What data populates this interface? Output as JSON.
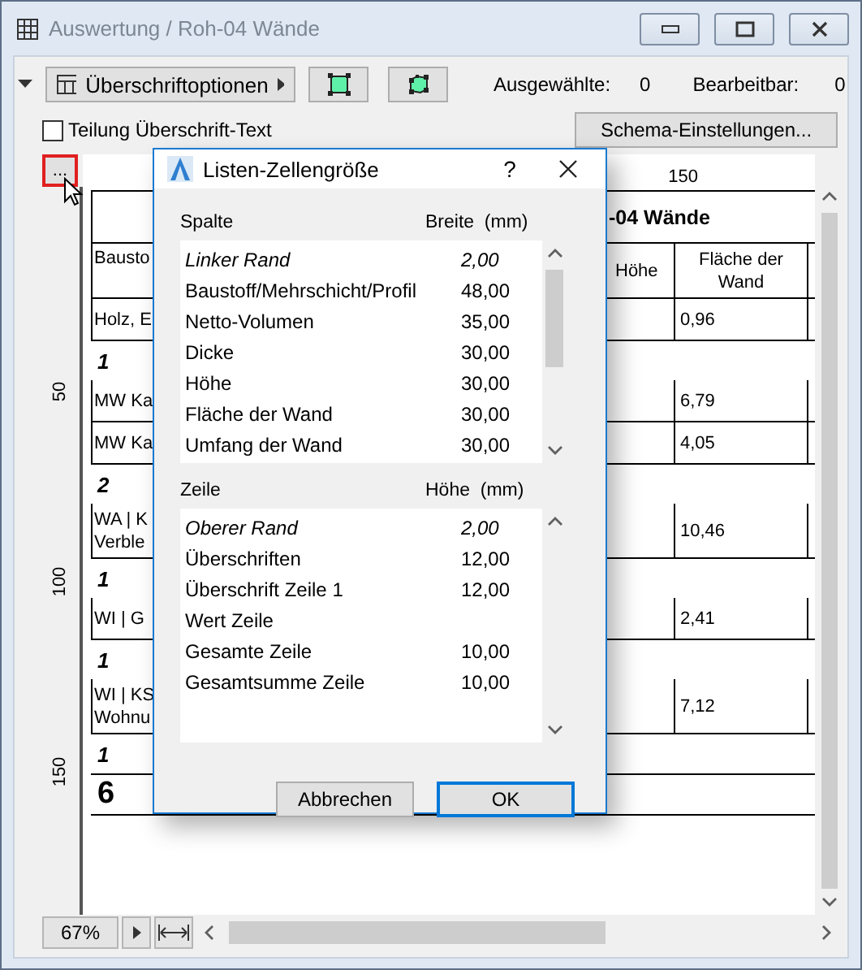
{
  "window": {
    "title": "Auswertung / Roh-04 Wände"
  },
  "toolbar": {
    "options_button": "Überschriftoptionen",
    "selected_label": "Ausgewählte:",
    "selected_count": "0",
    "editable_label": "Bearbeitbar:",
    "editable_count": "0"
  },
  "split_checkbox": {
    "label": "Teilung Überschrift-Text",
    "checked": false
  },
  "schema_button": "Schema-Einstellungen...",
  "more_button": "...",
  "ruler": {
    "top_label": "150",
    "side_labels": [
      "50",
      "100",
      "150"
    ]
  },
  "schedule": {
    "title": "-04 Wände",
    "header": {
      "first": "Bausto",
      "height": "Höhe",
      "area": [
        "Fläche der",
        "Wand"
      ]
    },
    "rows": [
      {
        "kind": "data",
        "first": [
          "Holz, E"
        ],
        "area": "0,96"
      },
      {
        "kind": "group",
        "label": "1"
      },
      {
        "kind": "data",
        "first": [
          "MW Ka"
        ],
        "area": "6,79"
      },
      {
        "kind": "data",
        "first": [
          "MW Ka"
        ],
        "area": "4,05"
      },
      {
        "kind": "group",
        "label": "2"
      },
      {
        "kind": "data",
        "first": [
          "WA | K",
          "Verble"
        ],
        "area": "10,46"
      },
      {
        "kind": "group",
        "label": "1"
      },
      {
        "kind": "data",
        "first": [
          "WI | G"
        ],
        "area": "2,41"
      },
      {
        "kind": "group",
        "label": "1"
      },
      {
        "kind": "data",
        "first": [
          "WI | KS",
          "Wohnu"
        ],
        "area": "7,12"
      },
      {
        "kind": "group",
        "label": "1"
      },
      {
        "kind": "total",
        "label": "6"
      }
    ]
  },
  "zoom": "67%",
  "dialog": {
    "title": "Listen-Zellengröße",
    "help": "?",
    "columns": {
      "heading": "Spalte",
      "unit_heading": "Breite  (mm)",
      "rows": [
        {
          "kind": "margin",
          "name": "Linker Rand",
          "value": "2,00"
        },
        {
          "kind": "item",
          "name": "Baustoff/Mehrschicht/Profil",
          "value": "48,00"
        },
        {
          "kind": "item",
          "name": "Netto-Volumen",
          "value": "35,00"
        },
        {
          "kind": "item",
          "name": "Dicke",
          "value": "30,00"
        },
        {
          "kind": "item",
          "name": "Höhe",
          "value": "30,00"
        },
        {
          "kind": "item",
          "name": "Fläche der Wand",
          "value": "30,00"
        },
        {
          "kind": "item",
          "name": "Umfang der Wand",
          "value": "30,00"
        }
      ]
    },
    "rows": {
      "heading": "Zeile",
      "unit_heading": "Höhe  (mm)",
      "rows": [
        {
          "kind": "margin",
          "name": "Oberer Rand",
          "value": "2,00"
        },
        {
          "kind": "item",
          "name": "Überschriften",
          "value": "12,00"
        },
        {
          "kind": "item",
          "name": "Überschrift Zeile 1",
          "value": "12,00"
        },
        {
          "kind": "item",
          "name": "Wert Zeile"
        },
        {
          "kind": "item",
          "name": "Gesamte Zeile",
          "value": "10,00"
        },
        {
          "kind": "item",
          "name": "Gesamtsumme Zeile",
          "value": "10,00"
        }
      ]
    },
    "buttons": [
      {
        "label": "Abbrechen",
        "default": false
      },
      {
        "label": "OK",
        "default": true
      }
    ]
  }
}
